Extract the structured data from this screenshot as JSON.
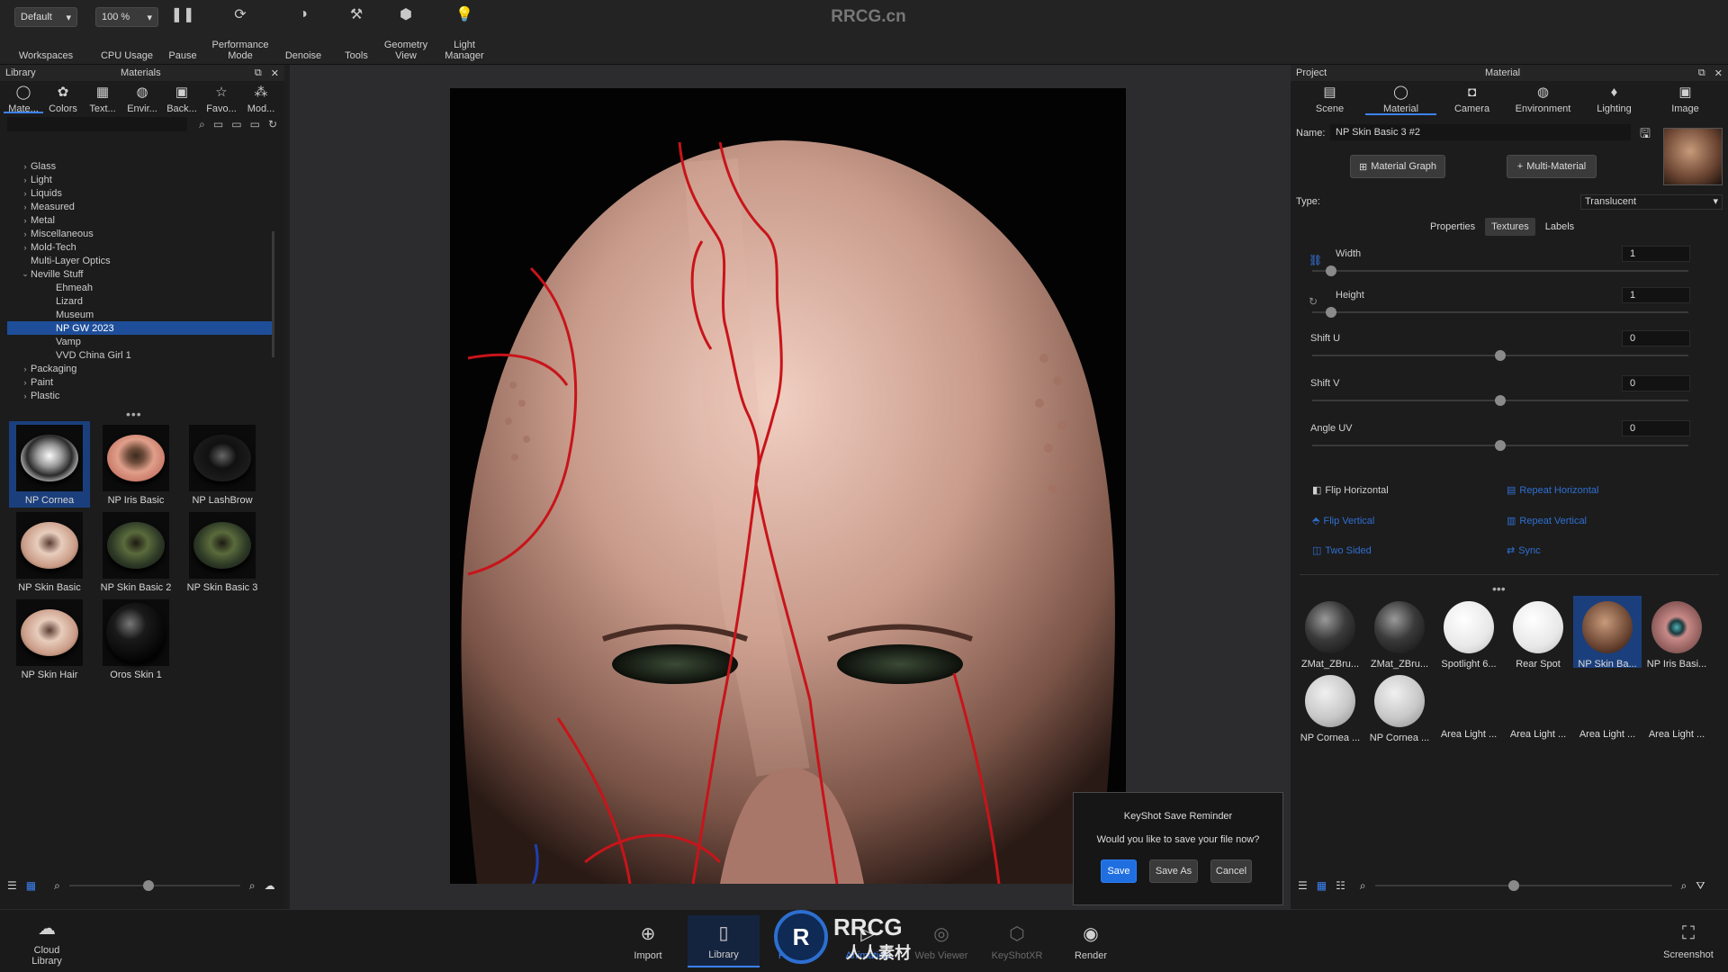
{
  "toolbar": {
    "workspace_value": "Default",
    "workspace_label": "Workspaces",
    "cpu_value": "100 %",
    "cpu_label": "CPU Usage",
    "pause_label": "Pause",
    "performance_label": "Performance\nMode",
    "denoise_label": "Denoise",
    "tools_label": "Tools",
    "geometry_label": "Geometry\nView",
    "light_label": "Light\nManager"
  },
  "watermark_brand": "RRCG.cn",
  "library": {
    "title": "Library",
    "section_title": "Materials",
    "tabs": [
      {
        "label": "Mate...",
        "icon": "material-icon"
      },
      {
        "label": "Colors",
        "icon": "palette-icon"
      },
      {
        "label": "Text...",
        "icon": "texture-icon"
      },
      {
        "label": "Envir...",
        "icon": "globe-icon"
      },
      {
        "label": "Back...",
        "icon": "image-icon"
      },
      {
        "label": "Favo...",
        "icon": "star-icon"
      },
      {
        "label": "Mod...",
        "icon": "models-icon"
      }
    ],
    "tree": [
      {
        "label": "Glass",
        "level": 0,
        "expand": "collapsed"
      },
      {
        "label": "Light",
        "level": 0,
        "expand": "collapsed"
      },
      {
        "label": "Liquids",
        "level": 0,
        "expand": "collapsed"
      },
      {
        "label": "Measured",
        "level": 0,
        "expand": "collapsed"
      },
      {
        "label": "Metal",
        "level": 0,
        "expand": "collapsed"
      },
      {
        "label": "Miscellaneous",
        "level": 0,
        "expand": "collapsed"
      },
      {
        "label": "Mold-Tech",
        "level": 0,
        "expand": "collapsed"
      },
      {
        "label": "Multi-Layer Optics",
        "level": 0,
        "expand": "none"
      },
      {
        "label": "Neville Stuff",
        "level": 0,
        "expand": "expanded"
      },
      {
        "label": "Ehmeah",
        "level": 1,
        "expand": "none"
      },
      {
        "label": "Lizard",
        "level": 1,
        "expand": "none"
      },
      {
        "label": "Museum",
        "level": 1,
        "expand": "none"
      },
      {
        "label": "NP GW 2023",
        "level": 1,
        "expand": "none",
        "selected": true
      },
      {
        "label": "Vamp",
        "level": 1,
        "expand": "none"
      },
      {
        "label": "VVD China Girl 1",
        "level": 1,
        "expand": "none"
      },
      {
        "label": "Packaging",
        "level": 0,
        "expand": "collapsed"
      },
      {
        "label": "Paint",
        "level": 0,
        "expand": "collapsed"
      },
      {
        "label": "Plastic",
        "level": 0,
        "expand": "collapsed"
      }
    ],
    "thumbnails": [
      {
        "label": "NP Cornea",
        "kind": "cornea",
        "selected": true
      },
      {
        "label": "NP Iris Basic",
        "kind": "iris"
      },
      {
        "label": "NP LashBrow",
        "kind": "lash"
      },
      {
        "label": "NP Skin Basic",
        "kind": "skin"
      },
      {
        "label": "NP Skin Basic 2",
        "kind": "skin2"
      },
      {
        "label": "NP Skin Basic 3",
        "kind": "skin2"
      },
      {
        "label": "NP Skin Hair",
        "kind": "skin"
      },
      {
        "label": "Oros Skin 1",
        "kind": "black"
      }
    ]
  },
  "save_dialog": {
    "title": "KeyShot Save Reminder",
    "message": "Would you like to save your file now?",
    "save": "Save",
    "save_as": "Save As",
    "cancel": "Cancel"
  },
  "project": {
    "title": "Project",
    "section_title": "Material",
    "tabs": [
      {
        "label": "Scene",
        "icon": "scene-icon"
      },
      {
        "label": "Material",
        "icon": "material-icon",
        "active": true
      },
      {
        "label": "Camera",
        "icon": "camera-icon"
      },
      {
        "label": "Environment",
        "icon": "environment-icon"
      },
      {
        "label": "Lighting",
        "icon": "bulb-icon"
      },
      {
        "label": "Image",
        "icon": "image-icon"
      }
    ],
    "name_label": "Name:",
    "name_value": "NP Skin Basic 3 #2",
    "material_graph": "Material Graph",
    "multi_material": "Multi-Material",
    "type_label": "Type:",
    "type_value": "Translucent",
    "subtabs": [
      "Properties",
      "Textures",
      "Labels"
    ],
    "active_subtab": "Textures",
    "props": [
      {
        "label": "Width",
        "value": "1",
        "slider": 0.05
      },
      {
        "label": "Height",
        "value": "1",
        "slider": 0.05
      },
      {
        "label": "Shift U",
        "value": "0",
        "slider": 0.5
      },
      {
        "label": "Shift V",
        "value": "0",
        "slider": 0.5
      },
      {
        "label": "Angle UV",
        "value": "0",
        "slider": 0.5
      }
    ],
    "options": {
      "flip_horizontal": "Flip Horizontal",
      "repeat_horizontal": "Repeat Horizontal",
      "flip_vertical": "Flip Vertical",
      "repeat_vertical": "Repeat Vertical",
      "two_sided": "Two Sided",
      "sync": "Sync"
    },
    "materials": [
      {
        "label": "ZMat_ZBru...",
        "kind": "dark"
      },
      {
        "label": "ZMat_ZBru...",
        "kind": "dark"
      },
      {
        "label": "Spotlight 6...",
        "kind": "white"
      },
      {
        "label": "Rear Spot",
        "kind": "white"
      },
      {
        "label": "NP Skin Ba...",
        "kind": "skin",
        "selected": true
      },
      {
        "label": "NP Iris Basi...",
        "kind": "iris"
      },
      {
        "label": "NP Cornea ...",
        "kind": "grey"
      },
      {
        "label": "NP Cornea ...",
        "kind": "grey"
      },
      {
        "label": "Area Light ...",
        "kind": "none"
      },
      {
        "label": "Area Light ...",
        "kind": "none"
      },
      {
        "label": "Area Light ...",
        "kind": "none"
      },
      {
        "label": "Area Light ...",
        "kind": "none"
      }
    ]
  },
  "bottom": {
    "cloud_library": "Cloud\nLibrary",
    "items": [
      {
        "label": "Import",
        "icon": "import-icon",
        "state": "normal"
      },
      {
        "label": "Library",
        "icon": "library-icon",
        "state": "active"
      },
      {
        "label": "Project",
        "icon": "project-icon",
        "state": "blue"
      },
      {
        "label": "Animation",
        "icon": "animation-icon",
        "state": "blue"
      },
      {
        "label": "Web Viewer",
        "icon": "web-viewer-icon",
        "state": "dim"
      },
      {
        "label": "KeyShotXR",
        "icon": "keyshotxr-icon",
        "state": "dim"
      },
      {
        "label": "Render",
        "icon": "render-icon",
        "state": "normal"
      }
    ],
    "screenshot": "Screenshot",
    "logo_text": "RRCG",
    "logo_sub": "人人素材"
  }
}
